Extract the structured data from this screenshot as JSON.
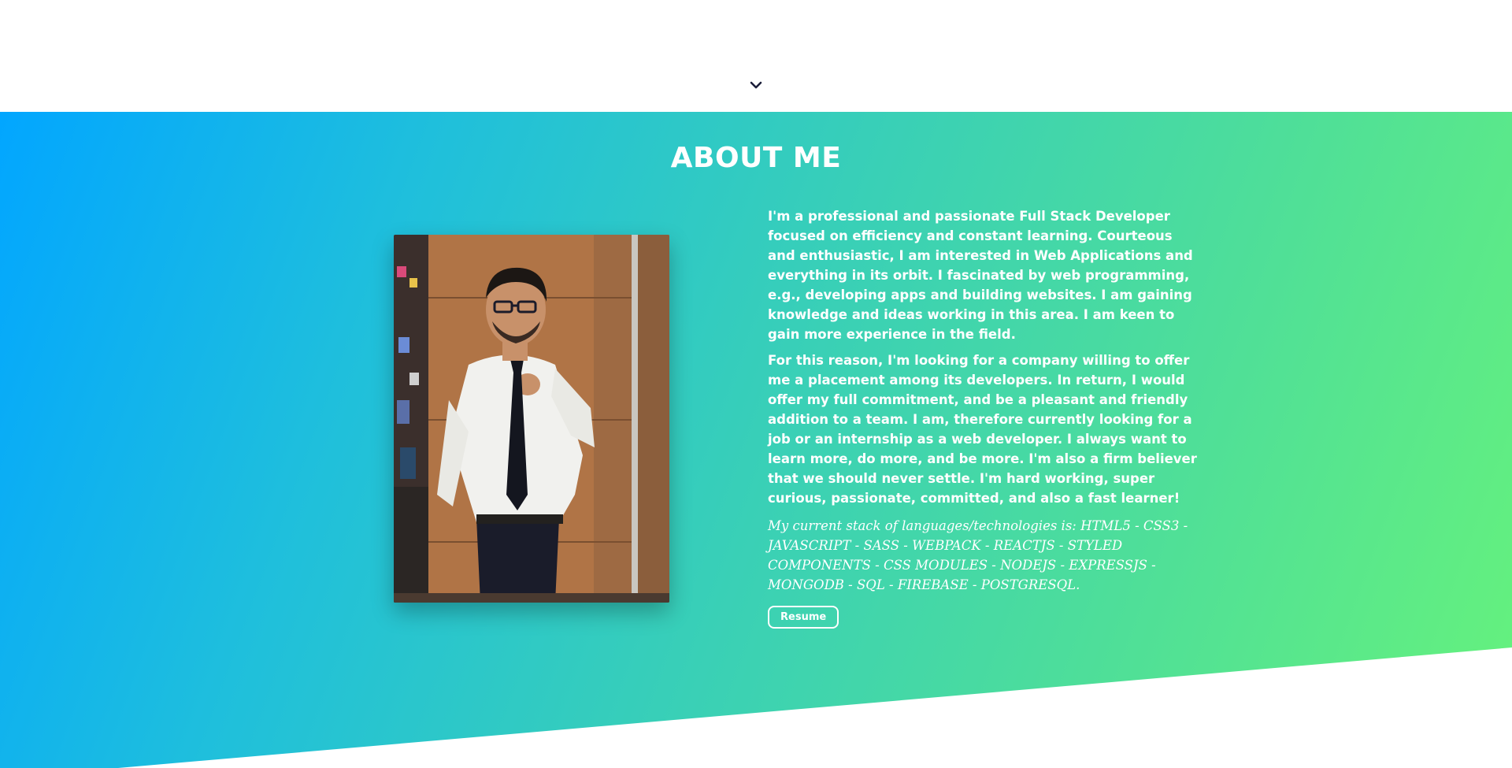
{
  "nav": {
    "scroll_icon": "chevron-down-icon"
  },
  "about": {
    "title": "ABOUT ME",
    "photo_icon": "profile-photo",
    "paragraph_1": "I'm a professional and passionate Full Stack Developer focused on efficiency and constant learning. Courteous and enthusiastic, I am interested in Web Applications and everything in its orbit. I fascinated by web programming, e.g., developing apps and building websites. I am gaining knowledge and ideas working in this area. I am keen to gain more experience in the field.",
    "paragraph_2": "For this reason, I'm looking for a company willing to offer me a placement among its developers. In return, I would offer my full commitment, and be a pleasant and friendly addition to a team. I am, therefore currently looking for a job or an internship as a web developer. I always want to learn more, do more, and be more. I'm also a firm believer that we should never settle. I'm hard working, super curious, passionate, committed, and also a fast learner!",
    "stack_text": "My current stack of languages/technologies is: HTML5 - CSS3 - JAVASCRIPT - SASS - WEBPACK - REACTJS - STYLED COMPONENTS - CSS MODULES - NODEJS - EXPRESSJS - MONGODB - SQL - FIREBASE - POSTGRESQL.",
    "resume_label": "Resume"
  },
  "colors": {
    "gradient_start": "#02a6ff",
    "gradient_end": "#66f27c",
    "text": "#ffffff",
    "arrow": "#1c1f3a"
  }
}
